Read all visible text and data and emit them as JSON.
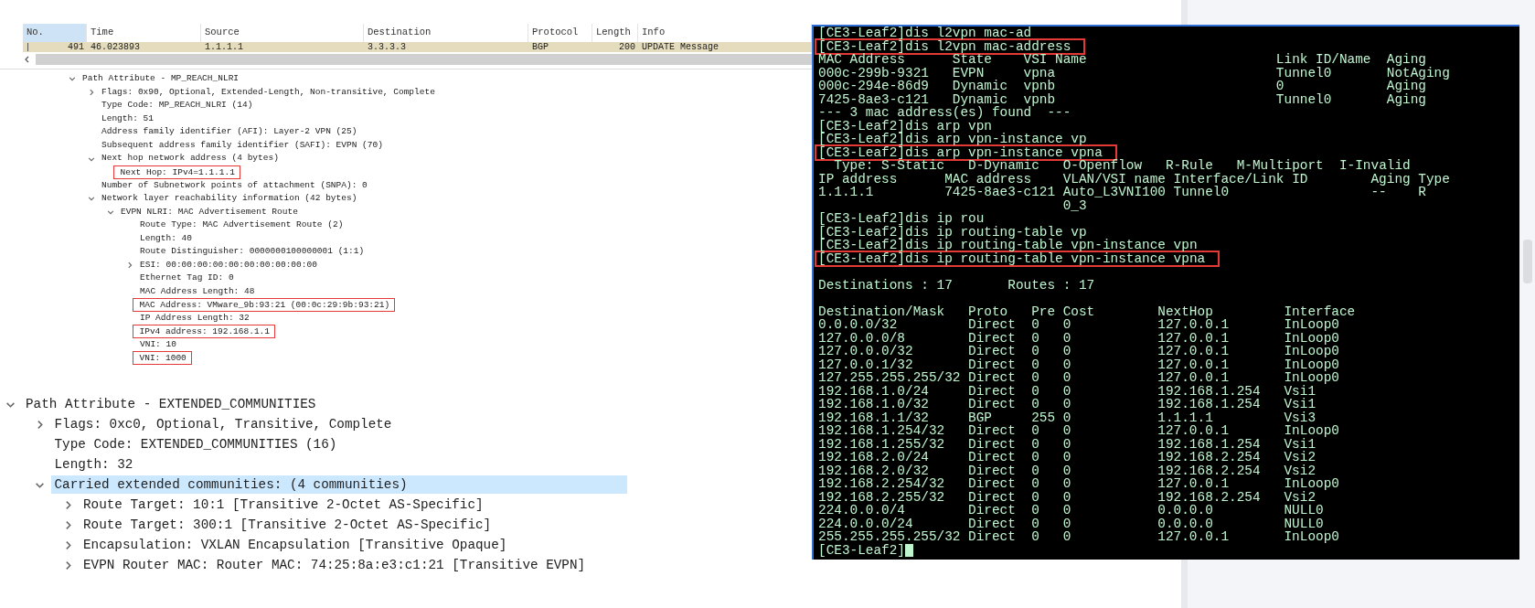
{
  "packet_list": {
    "columns": [
      {
        "label": "No.",
        "selected": true
      },
      {
        "label": "Time",
        "selected": false
      },
      {
        "label": "Source",
        "selected": false
      },
      {
        "label": "Destination",
        "selected": false
      },
      {
        "label": "Protocol",
        "selected": false
      },
      {
        "label": "Length",
        "selected": false
      },
      {
        "label": "Info",
        "selected": false
      }
    ],
    "rows": [
      [
        "491",
        "46.023893",
        "1.1.1.1",
        "3.3.3.3",
        "BGP",
        "200",
        "UPDATE Message"
      ]
    ]
  },
  "packet_details_upper": {
    "items": [
      {
        "label": "Path Attribute - MP_REACH_NLRI",
        "expanded": true,
        "boxed": false,
        "children": [
          {
            "label": "Flags: 0x90, Optional, Extended-Length, Non-transitive, Complete",
            "expanded": false,
            "boxed": false
          },
          {
            "label": "Type Code: MP_REACH_NLRI (14)",
            "boxed": false
          },
          {
            "label": "Length: 51",
            "boxed": false
          },
          {
            "label": "Address family identifier (AFI): Layer-2 VPN (25)",
            "boxed": false
          },
          {
            "label": "Subsequent address family identifier (SAFI): EVPN (70)",
            "boxed": false
          },
          {
            "label": "Next hop network address (4 bytes)",
            "expanded": true,
            "boxed": false,
            "children": [
              {
                "label": "Next Hop: IPv4=1.1.1.1",
                "boxed": true
              }
            ]
          },
          {
            "label": "Number of Subnetwork points of attachment (SNPA): 0",
            "boxed": false
          },
          {
            "label": "Network layer reachability information (42 bytes)",
            "expanded": true,
            "boxed": false,
            "children": [
              {
                "label": "EVPN NLRI: MAC Advertisement Route",
                "expanded": true,
                "boxed": false,
                "children": [
                  {
                    "label": "Route Type: MAC Advertisement Route (2)",
                    "boxed": false
                  },
                  {
                    "label": "Length: 40",
                    "boxed": false
                  },
                  {
                    "label": "Route Distinguisher: 0000000100000001 (1:1)",
                    "boxed": false
                  },
                  {
                    "label": "ESI: 00:00:00:00:00:00:00:00:00:00",
                    "expanded": false,
                    "boxed": false
                  },
                  {
                    "label": "Ethernet Tag ID: 0",
                    "boxed": false
                  },
                  {
                    "label": "MAC Address Length: 48",
                    "boxed": false
                  },
                  {
                    "label": "MAC Address: VMware_9b:93:21 (00:0c:29:9b:93:21)",
                    "boxed": true
                  },
                  {
                    "label": "IP Address Length: 32",
                    "boxed": false
                  },
                  {
                    "label": "IPv4 address: 192.168.1.1",
                    "boxed": true
                  },
                  {
                    "label": "VNI: 10",
                    "boxed": false
                  },
                  {
                    "label": "VNI: 1000",
                    "boxed": true
                  }
                ]
              }
            ]
          }
        ]
      }
    ]
  },
  "packet_details_lower": {
    "items": [
      {
        "label": "Path Attribute - EXTENDED_COMMUNITIES",
        "expanded": true,
        "selected": false,
        "children": [
          {
            "label": "Flags: 0xc0, Optional, Transitive, Complete",
            "expanded": false,
            "selected": false
          },
          {
            "label": "Type Code: EXTENDED_COMMUNITIES (16)",
            "selected": false
          },
          {
            "label": "Length: 32",
            "selected": false
          },
          {
            "label": "Carried extended communities: (4 communities)",
            "expanded": true,
            "selected": true,
            "children": [
              {
                "label": "Route Target: 10:1 [Transitive 2-Octet AS-Specific]",
                "expanded": false,
                "selected": false
              },
              {
                "label": "Route Target: 300:1 [Transitive 2-Octet AS-Specific]",
                "expanded": false,
                "selected": false
              },
              {
                "label": "Encapsulation: VXLAN Encapsulation [Transitive Opaque]",
                "expanded": false,
                "selected": false
              },
              {
                "label": "EVPN Router MAC: Router MAC: 74:25:8a:e3:c1:21 [Transitive EVPN]",
                "expanded": false,
                "selected": false
              }
            ]
          }
        ]
      }
    ]
  },
  "terminal": {
    "lines": [
      {
        "kind": "command",
        "text": "[CE3-Leaf2]dis l2vpn mac-ad",
        "boxed": false
      },
      {
        "kind": "command",
        "text": "[CE3-Leaf2]dis l2vpn mac-address",
        "boxed": true
      },
      {
        "kind": "mac_table",
        "columns": [
          "MAC Address",
          "State",
          "VSI Name",
          "Link ID/Name",
          "Aging"
        ],
        "rows": [
          [
            "000c-299b-9321",
            "EVPN",
            "vpna",
            "Tunnel0",
            "NotAging"
          ],
          [
            "000c-294e-86d9",
            "Dynamic",
            "vpnb",
            "0",
            "Aging"
          ],
          [
            "7425-8ae3-c121",
            "Dynamic",
            "vpnb",
            "Tunnel0",
            "Aging"
          ]
        ]
      },
      {
        "kind": "output",
        "text": "--- 3 mac address(es) found  ---"
      },
      {
        "kind": "command",
        "text": "[CE3-Leaf2]dis arp vpn",
        "boxed": false
      },
      {
        "kind": "command",
        "text": "[CE3-Leaf2]dis arp vpn-instance vp",
        "boxed": false
      },
      {
        "kind": "command",
        "text": "[CE3-Leaf2]dis arp vpn-instance vpna",
        "boxed": true
      },
      {
        "kind": "output",
        "text": "  Type: S-Static   D-Dynamic   O-Openflow   R-Rule   M-Multiport  I-Invalid"
      },
      {
        "kind": "arp_table",
        "columns": [
          "IP address",
          "MAC address",
          "VLAN/VSI name",
          "Interface/Link ID",
          "Aging",
          "Type"
        ],
        "rows": [
          {
            "cells": [
              "1.1.1.1",
              "7425-8ae3-c121",
              "Auto_L3VNI100",
              "Tunnel0",
              "--",
              "R"
            ],
            "wrapped": "0_3"
          }
        ]
      },
      {
        "kind": "command",
        "text": "[CE3-Leaf2]dis ip rou",
        "boxed": false
      },
      {
        "kind": "command",
        "text": "[CE3-Leaf2]dis ip routing-table vp",
        "boxed": false
      },
      {
        "kind": "command",
        "text": "[CE3-Leaf2]dis ip routing-table vpn-instance vpn",
        "boxed": false
      },
      {
        "kind": "command",
        "text": "[CE3-Leaf2]dis ip routing-table vpn-instance vpna",
        "boxed": true
      },
      {
        "kind": "blank"
      },
      {
        "kind": "summary",
        "items": [
          "Destinations : 17",
          "Routes : 17"
        ]
      },
      {
        "kind": "blank"
      },
      {
        "kind": "route_table",
        "columns": [
          "Destination/Mask",
          "Proto",
          "Pre",
          "Cost",
          "NextHop",
          "Interface"
        ],
        "rows": [
          [
            "0.0.0.0/32",
            "Direct",
            "0",
            "0",
            "127.0.0.1",
            "InLoop0"
          ],
          [
            "127.0.0.0/8",
            "Direct",
            "0",
            "0",
            "127.0.0.1",
            "InLoop0"
          ],
          [
            "127.0.0.0/32",
            "Direct",
            "0",
            "0",
            "127.0.0.1",
            "InLoop0"
          ],
          [
            "127.0.0.1/32",
            "Direct",
            "0",
            "0",
            "127.0.0.1",
            "InLoop0"
          ],
          [
            "127.255.255.255/32",
            "Direct",
            "0",
            "0",
            "127.0.0.1",
            "InLoop0"
          ],
          [
            "192.168.1.0/24",
            "Direct",
            "0",
            "0",
            "192.168.1.254",
            "Vsi1"
          ],
          [
            "192.168.1.0/32",
            "Direct",
            "0",
            "0",
            "192.168.1.254",
            "Vsi1"
          ],
          [
            "192.168.1.1/32",
            "BGP",
            "255",
            "0",
            "1.1.1.1",
            "Vsi3"
          ],
          [
            "192.168.1.254/32",
            "Direct",
            "0",
            "0",
            "127.0.0.1",
            "InLoop0"
          ],
          [
            "192.168.1.255/32",
            "Direct",
            "0",
            "0",
            "192.168.1.254",
            "Vsi1"
          ],
          [
            "192.168.2.0/24",
            "Direct",
            "0",
            "0",
            "192.168.2.254",
            "Vsi2"
          ],
          [
            "192.168.2.0/32",
            "Direct",
            "0",
            "0",
            "192.168.2.254",
            "Vsi2"
          ],
          [
            "192.168.2.254/32",
            "Direct",
            "0",
            "0",
            "127.0.0.1",
            "InLoop0"
          ],
          [
            "192.168.2.255/32",
            "Direct",
            "0",
            "0",
            "192.168.2.254",
            "Vsi2"
          ],
          [
            "224.0.0.0/4",
            "Direct",
            "0",
            "0",
            "0.0.0.0",
            "NULL0"
          ],
          [
            "224.0.0.0/24",
            "Direct",
            "0",
            "0",
            "0.0.0.0",
            "NULL0"
          ],
          [
            "255.255.255.255/32",
            "Direct",
            "0",
            "0",
            "127.0.0.1",
            "InLoop0"
          ]
        ]
      },
      {
        "kind": "prompt",
        "text": "[CE3-Leaf2]"
      }
    ]
  }
}
